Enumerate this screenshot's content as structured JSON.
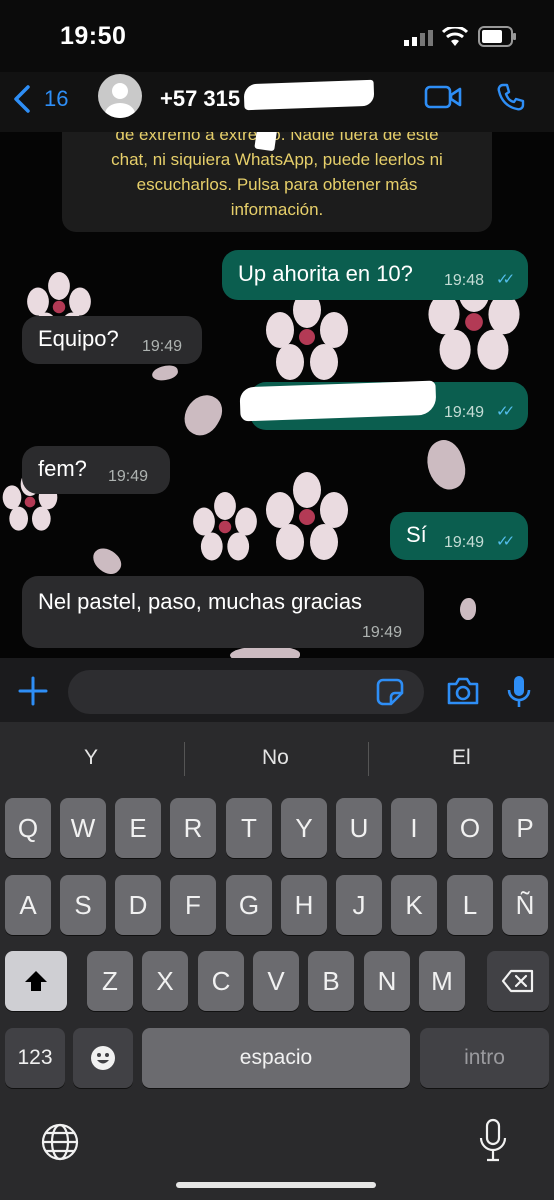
{
  "status_bar": {
    "time": "19:50"
  },
  "header": {
    "back_count": "16",
    "contact_name": "+57 315"
  },
  "chat": {
    "system_message": "de extremo a extremo. Nadie fuera de este chat, ni siquiera WhatsApp, puede leerlos ni escucharlos. Pulsa para obtener más información.",
    "system_lines": [
      "de extremo a extremo. Nadie fuera de este",
      "chat, ni siquiera WhatsApp, puede leerlos ni",
      "escucharlos. Pulsa para obtener más",
      "información."
    ],
    "messages": [
      {
        "dir": "out",
        "text": "Up ahorita en 10?",
        "time": "19:48"
      },
      {
        "dir": "in",
        "text": "Equipo?",
        "time": "19:49"
      },
      {
        "dir": "out",
        "text": "",
        "time": "19:49"
      },
      {
        "dir": "in",
        "text": "fem?",
        "time": "19:49"
      },
      {
        "dir": "out",
        "text": "Sí",
        "time": "19:49"
      },
      {
        "dir": "in",
        "text": "Nel pastel, paso, muchas gracias",
        "time": "19:49"
      }
    ]
  },
  "keyboard": {
    "suggestions": [
      "Y",
      "No",
      "El"
    ],
    "row1": [
      "Q",
      "W",
      "E",
      "R",
      "T",
      "Y",
      "U",
      "I",
      "O",
      "P"
    ],
    "row2": [
      "A",
      "S",
      "D",
      "F",
      "G",
      "H",
      "J",
      "K",
      "L",
      "Ñ"
    ],
    "row3": [
      "Z",
      "X",
      "C",
      "V",
      "B",
      "N",
      "M"
    ],
    "numbers_label": "123",
    "space_label": "espacio",
    "return_label": "intro"
  },
  "colors": {
    "accent": "#2e8ef6",
    "outgoing_bubble": "#0b5e4f",
    "incoming_bubble": "#2b2b2d",
    "read_ticks": "#53bdeb"
  }
}
